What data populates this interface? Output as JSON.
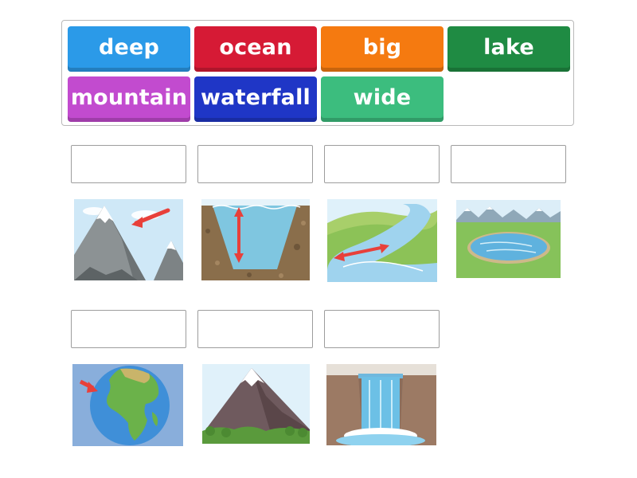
{
  "word_bank": {
    "tiles": [
      {
        "label": "deep",
        "color": "#2b9ae8"
      },
      {
        "label": "ocean",
        "color": "#d61a35"
      },
      {
        "label": "big",
        "color": "#f57a10"
      },
      {
        "label": "lake",
        "color": "#1f8b43"
      },
      {
        "label": "mountain",
        "color": "#c24bcf"
      },
      {
        "label": "waterfall",
        "color": "#1f36c6"
      },
      {
        "label": "wide",
        "color": "#3cbd7e"
      }
    ]
  },
  "answer_slots": {
    "row1": [
      "",
      "",
      "",
      ""
    ],
    "row2": [
      "",
      "",
      ""
    ]
  },
  "pictures": {
    "row1": [
      "tall-mountain-with-arrow",
      "deep-water-cross-section",
      "wide-river-with-arrow",
      "lake-landscape"
    ],
    "row2": [
      "globe-ocean-with-arrow",
      "big-mountain",
      "waterfall"
    ]
  },
  "colors": {
    "arrow": "#e8403a",
    "water": "#7cc3e6",
    "grass": "#7fbf4d"
  }
}
